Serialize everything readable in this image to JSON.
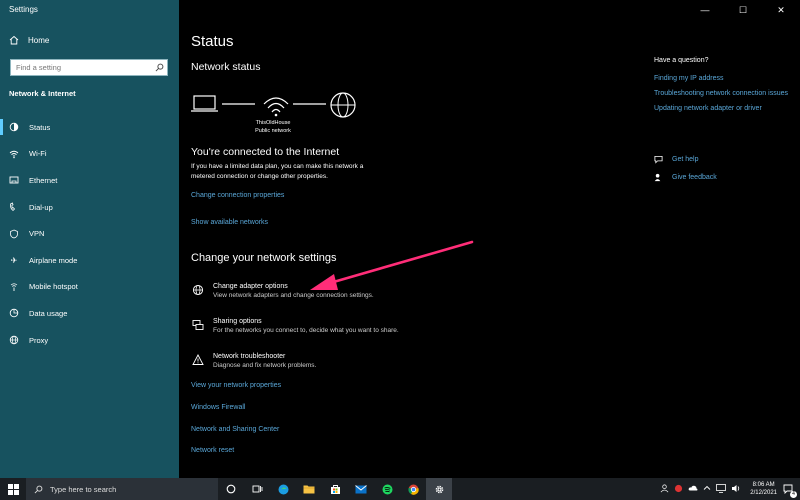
{
  "app": {
    "title": "Settings"
  },
  "window_controls": {
    "minimize": "—",
    "maximize": "☐",
    "close": "✕"
  },
  "sidebar": {
    "home_label": "Home",
    "search_placeholder": "Find a setting",
    "section": "Network & Internet",
    "items": [
      {
        "label": "Status",
        "icon": "status-icon"
      },
      {
        "label": "Wi-Fi",
        "icon": "wifi-icon"
      },
      {
        "label": "Ethernet",
        "icon": "ethernet-icon"
      },
      {
        "label": "Dial-up",
        "icon": "dialup-icon"
      },
      {
        "label": "VPN",
        "icon": "vpn-icon"
      },
      {
        "label": "Airplane mode",
        "icon": "airplane-icon"
      },
      {
        "label": "Mobile hotspot",
        "icon": "hotspot-icon"
      },
      {
        "label": "Data usage",
        "icon": "data-usage-icon"
      },
      {
        "label": "Proxy",
        "icon": "proxy-icon"
      }
    ]
  },
  "main": {
    "title": "Status",
    "network_status_heading": "Network status",
    "network_name": "ThisOldHouse",
    "network_type": "Public network",
    "connected_heading": "You're connected to the Internet",
    "connected_desc_1": "If you have a limited data plan, you can make this network a",
    "connected_desc_2": "metered connection or change other properties.",
    "link_change_connection": "Change connection properties",
    "link_show_networks": "Show available networks",
    "change_heading": "Change your network settings",
    "options": [
      {
        "title": "Change adapter options",
        "desc": "View network adapters and change connection settings."
      },
      {
        "title": "Sharing options",
        "desc": "For the networks you connect to, decide what you want to share."
      },
      {
        "title": "Network troubleshooter",
        "desc": "Diagnose and fix network problems."
      }
    ],
    "links": [
      "View your network properties",
      "Windows Firewall",
      "Network and Sharing Center",
      "Network reset"
    ]
  },
  "right_panel": {
    "heading": "Have a question?",
    "links": [
      "Finding my IP address",
      "Troubleshooting network connection issues",
      "Updating network adapter or driver"
    ],
    "get_help": "Get help",
    "give_feedback": "Give feedback"
  },
  "taskbar": {
    "search_placeholder": "Type here to search",
    "time": "8:06 AM",
    "date": "2/12/2021",
    "notification_count": "4"
  },
  "colors": {
    "sidebar_bg": "#17525f",
    "link": "#5aa7d8",
    "arrow": "#ff2d78"
  }
}
